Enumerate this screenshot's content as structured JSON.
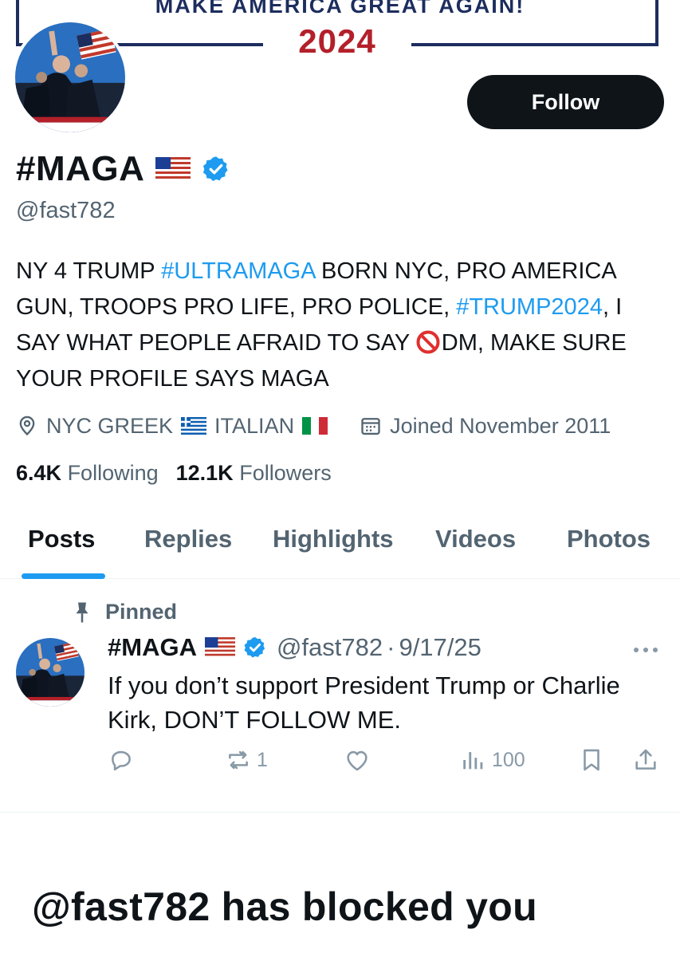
{
  "banner": {
    "slogan": "MAKE AMERICA GREAT AGAIN!",
    "year": "2024"
  },
  "colors": {
    "accent": "#1d9bf0",
    "text_primary": "#0f1419",
    "text_secondary": "#536471",
    "banner_navy": "#1c2d5e",
    "banner_red": "#b3202a"
  },
  "profile": {
    "follow_label": "Follow",
    "display_name": "#MAGA",
    "handle": "@fast782",
    "bio": {
      "p1": "NY 4 TRUMP ",
      "tag1": "#ULTRAMAGA",
      "p2": " BORN NYC, PRO AMERICA GUN, TROOPS PRO LIFE, PRO POLICE, ",
      "tag2": "#TRUMP2024",
      "p3": ", I SAY WHAT PEOPLE AFRAID TO SAY ",
      "p4": "DM, MAKE SURE YOUR PROFILE SAYS MAGA"
    },
    "location_part1": "NYC GREEK",
    "location_part2": "ITALIAN",
    "joined": "Joined November 2011",
    "following_count": "6.4K",
    "following_label": "Following",
    "followers_count": "12.1K",
    "followers_label": "Followers"
  },
  "tabs": [
    "Posts",
    "Replies",
    "Highlights",
    "Videos",
    "Photos"
  ],
  "active_tab": "Posts",
  "pinned_post": {
    "pinned_label": "Pinned",
    "author_name": "#MAGA",
    "author_handle": "@fast782",
    "separator": "·",
    "date": "9/17/25",
    "text": "If you don’t support President Trump or Charlie Kirk, DON’T FOLLOW ME.",
    "reposts": "1",
    "views": "100"
  },
  "blocked_message": "@fast782 has blocked you",
  "icons": [
    "location-pin-icon",
    "calendar-icon",
    "verified-badge-icon",
    "pin-icon",
    "more-icon",
    "reply-icon",
    "repost-icon",
    "like-icon",
    "views-icon",
    "bookmark-icon",
    "share-icon",
    "no-entry-icon"
  ]
}
